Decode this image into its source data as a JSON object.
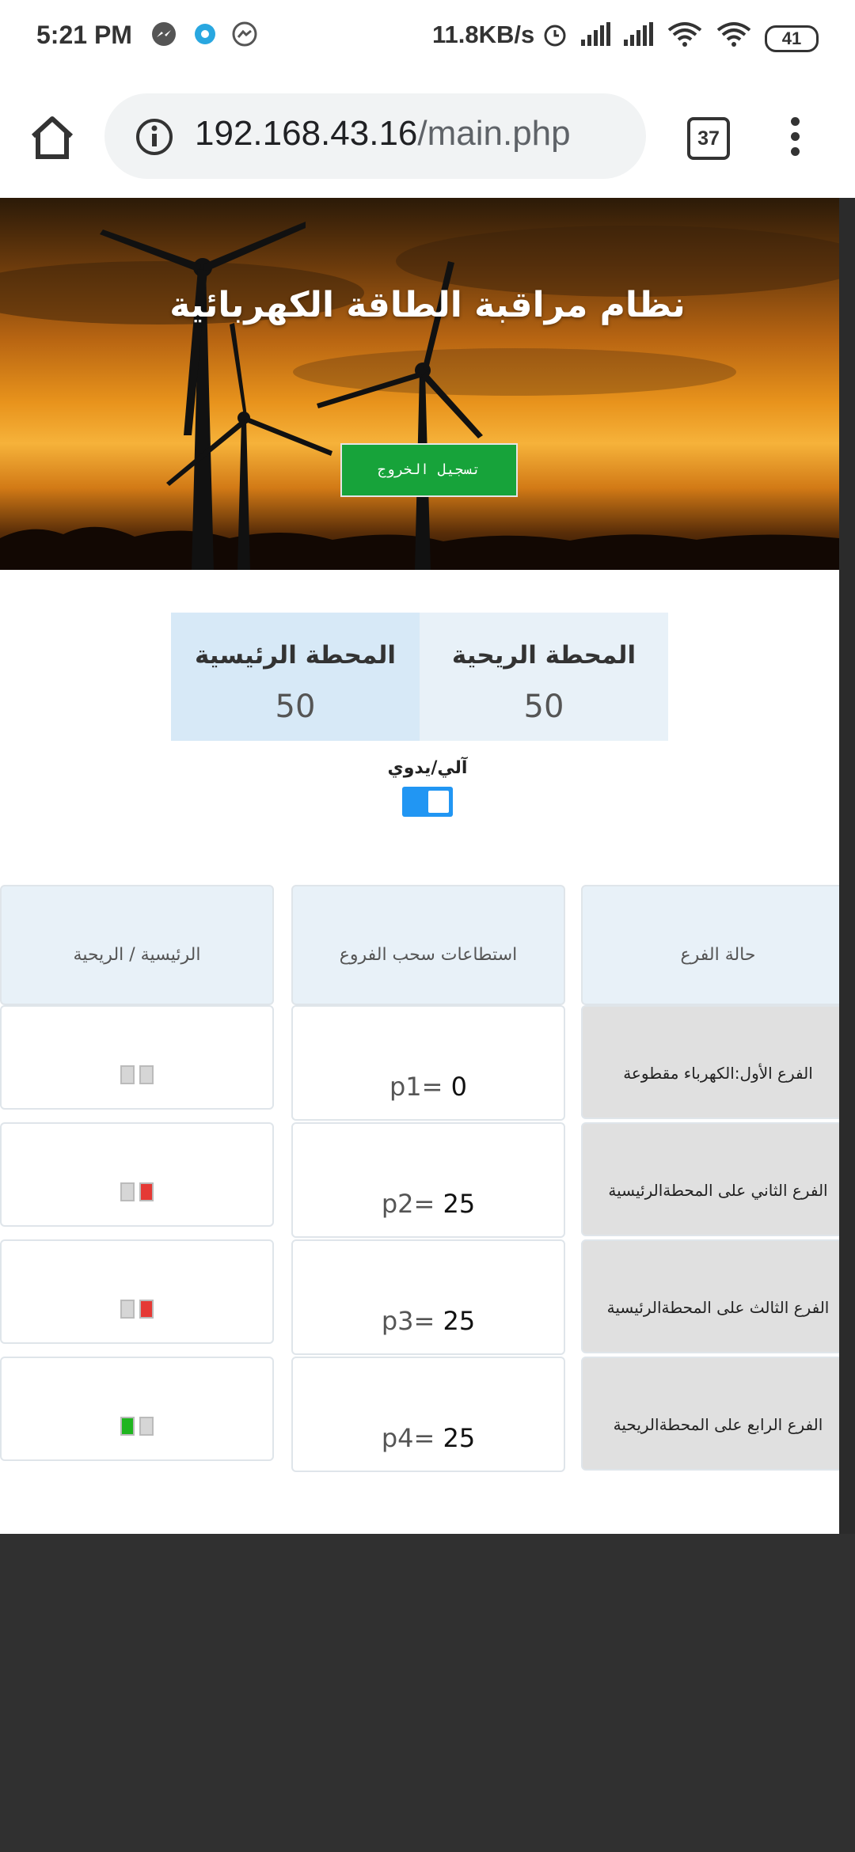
{
  "status_bar": {
    "time": "5:21 PM",
    "speed": "11.8KB/s",
    "battery": "41",
    "icons": [
      "messenger-icon",
      "circle-app-icon",
      "messenger-outline-icon",
      "alarm-icon",
      "signal-icon",
      "signal-icon",
      "wifi-icon",
      "wifi-icon"
    ]
  },
  "browser": {
    "url_host": "192.168.43.16",
    "url_path": "/main.php",
    "tab_count": "37"
  },
  "header": {
    "title": "نظام مراقبة الطاقة الكهربائية",
    "logout_label": "تسجيل الخروج"
  },
  "stations": {
    "main": {
      "name": "المحطة الرئيسية",
      "value": "50"
    },
    "wind": {
      "name": "المحطة الريحية",
      "value": "50"
    }
  },
  "mode": {
    "label": "آلي/يدوي",
    "toggle_on": true
  },
  "table": {
    "headers": {
      "status": "حالة الفرع",
      "draw": "استطاعات سحب الفروع",
      "source": "الرئيسية / الريحية"
    },
    "rows": [
      {
        "status": "الفرع الأول:الكهرباء مقطوعة",
        "draw_label": "p1=",
        "draw_value": "0",
        "lights": [
          "off",
          "off"
        ]
      },
      {
        "status": "الفرع الثاني على المحطةالرئيسية",
        "draw_label": "p2=",
        "draw_value": "25",
        "lights": [
          "off",
          "red"
        ]
      },
      {
        "status": "الفرع الثالث على المحطةالرئيسية",
        "draw_label": "p3=",
        "draw_value": "25",
        "lights": [
          "off",
          "red"
        ]
      },
      {
        "status": "الفرع الرابع على المحطةالريحية",
        "draw_label": "p4=",
        "draw_value": "25",
        "lights": [
          "green",
          "off"
        ]
      }
    ]
  },
  "colors": {
    "accent_blue": "#2196f3",
    "logout_green": "#17a33a",
    "light_red": "#e53935",
    "light_green": "#1fb51f"
  }
}
